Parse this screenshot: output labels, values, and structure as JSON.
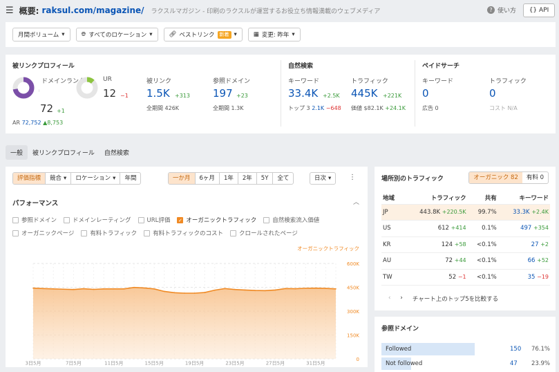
{
  "header": {
    "title_prefix": "概要:",
    "url": "raksul.com/magazine/",
    "subtitle": "ラクスルマガジン - 印刷のラクスルが運営するお役立ち情報満載のウェブメディア",
    "howto": "使い方",
    "api": "API"
  },
  "filters": {
    "volume": "月間ボリューム",
    "location": "すべてのロケーション",
    "best_links": "ベストリンク",
    "best_links_badge": "新着",
    "change": "変更: 昨年"
  },
  "backlink": {
    "title": "被リンクプロフィール",
    "dr_label": "ドメインランク",
    "dr_value": "72",
    "dr_delta": "+1",
    "ar_label": "AR",
    "ar_value": "72,752",
    "ar_delta": "▲8,753",
    "ur_label": "UR",
    "ur_value": "12",
    "ur_delta": "−1",
    "links_label": "被リンク",
    "links_value": "1.5K",
    "links_delta": "+313",
    "links_total": "全期間 426K",
    "rd_label": "参照ドメイン",
    "rd_value": "197",
    "rd_delta": "+23",
    "rd_total": "全期間 1.3K"
  },
  "organic": {
    "title": "自然検索",
    "kw_label": "キーワード",
    "kw_value": "33.4K",
    "kw_delta": "+2.5K",
    "top3_label": "トップ 3",
    "top3_value": "2.1K",
    "top3_delta": "−648",
    "traffic_label": "トラフィック",
    "traffic_value": "445K",
    "traffic_delta": "+221K",
    "value_label": "価値",
    "value_value": "$82.1K",
    "value_delta": "+24.1K"
  },
  "paid": {
    "title": "ペイドサーチ",
    "kw_label": "キーワード",
    "kw_value": "0",
    "ads_label": "広告",
    "ads_value": "0",
    "traffic_label": "トラフィック",
    "traffic_value": "0",
    "cost_label": "コスト",
    "cost_value": "N/A"
  },
  "tabs": [
    "一般",
    "被リンクプロフィール",
    "自然検索"
  ],
  "controls": {
    "group1": [
      "評価指標",
      "競合",
      "ロケーション",
      "年間"
    ],
    "group2": [
      "一か月",
      "6ヶ月",
      "1年",
      "2年",
      "5Y",
      "全て"
    ],
    "interval": "日次"
  },
  "performance": {
    "title": "パフォーマンス",
    "row1": [
      {
        "label": "参照ドメイン",
        "checked": false
      },
      {
        "label": "ドメインレーティング",
        "checked": false
      },
      {
        "label": "URL評価",
        "checked": false
      },
      {
        "label": "オーガニックトラフィック",
        "checked": true
      },
      {
        "label": "自然検索流入価値",
        "checked": false
      }
    ],
    "row2": [
      {
        "label": "オーガニックページ",
        "checked": false
      },
      {
        "label": "有料トラフィック",
        "checked": false
      },
      {
        "label": "有料トラフィックのコスト",
        "checked": false
      },
      {
        "label": "クロールされたページ",
        "checked": false
      }
    ],
    "legend": "オーガニックトラフィック"
  },
  "chart_data": {
    "type": "area",
    "title": "",
    "series": [
      {
        "name": "オーガニックトラフィック",
        "values": [
          445,
          442,
          440,
          438,
          436,
          441,
          437,
          440,
          440,
          440,
          449,
          446,
          440,
          424,
          416,
          413,
          413,
          417,
          432,
          442,
          436,
          433,
          430,
          429,
          433,
          442,
          441,
          444,
          445,
          443,
          440
        ],
        "color": "#f08a24"
      }
    ],
    "x": [
      "3日5月",
      "4日5月",
      "5日5月",
      "6日5月",
      "7日5月",
      "8日5月",
      "9日5月",
      "10日5月",
      "11日5月",
      "12日5月",
      "13日5月",
      "14日5月",
      "15日5月",
      "16日5月",
      "17日5月",
      "18日5月",
      "19日5月",
      "20日5月",
      "21日5月",
      "22日5月",
      "23日5月",
      "24日5月",
      "25日5月",
      "26日5月",
      "27日5月",
      "28日5月",
      "29日5月",
      "30日5月",
      "31日5月",
      "1日6月",
      "2日6月"
    ],
    "x_ticks": [
      "3日5月",
      "7日5月",
      "11日5月",
      "15日5月",
      "19日5月",
      "23日5月",
      "27日5月",
      "31日5月"
    ],
    "y_ticks": [
      "600K",
      "450K",
      "300K",
      "150K",
      "0"
    ],
    "ylim": [
      0,
      600
    ],
    "unit": "K"
  },
  "country_traffic": {
    "title": "場所別のトラフィック",
    "tabs": [
      "オーガニック 82",
      "有料 0"
    ],
    "headers": [
      "地域",
      "トラフィック",
      "共有",
      "キーワード"
    ],
    "rows": [
      {
        "country": "JP",
        "traffic": "443.8K",
        "tdelta": "+220.5K",
        "share": "99.7%",
        "kw": "33.3K",
        "kdelta": "+2.4K"
      },
      {
        "country": "US",
        "traffic": "612",
        "tdelta": "+414",
        "share": "0.1%",
        "kw": "497",
        "kdelta": "+354"
      },
      {
        "country": "KR",
        "traffic": "124",
        "tdelta": "+58",
        "share": "<0.1%",
        "kw": "27",
        "kdelta": "+2"
      },
      {
        "country": "AU",
        "traffic": "72",
        "tdelta": "+44",
        "share": "<0.1%",
        "kw": "66",
        "kdelta": "+52"
      },
      {
        "country": "TW",
        "traffic": "52",
        "tdelta": "−1",
        "share": "<0.1%",
        "kw": "35",
        "kdelta": "−19"
      }
    ],
    "compare": "チャート上のトップ5を比較する"
  },
  "ref_domains": {
    "title": "参照ドメイン",
    "rows": [
      {
        "label": "Followed",
        "value": "150",
        "pct": "76.1%",
        "fraction": 0.761
      },
      {
        "label": "Not followed",
        "value": "47",
        "pct": "23.9%",
        "fraction": 0.239
      }
    ]
  }
}
